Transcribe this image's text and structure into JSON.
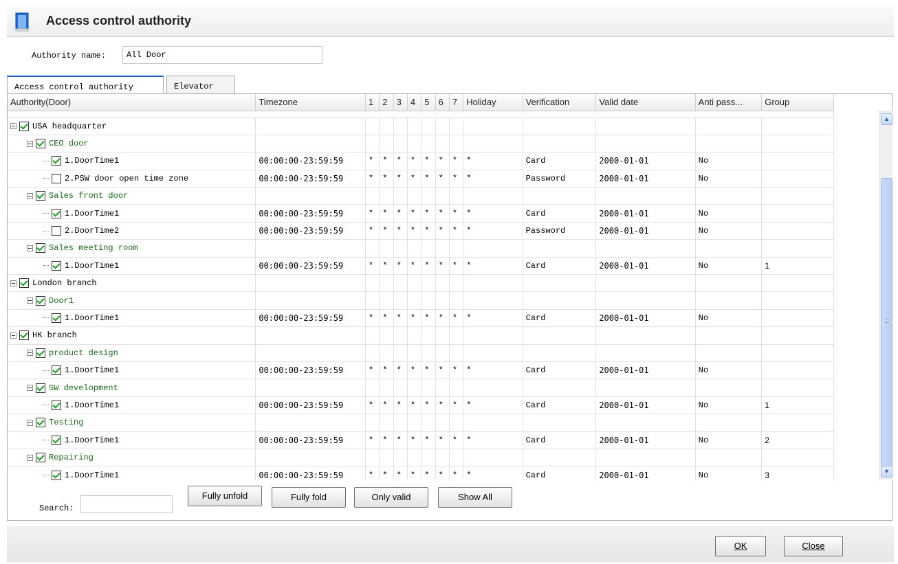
{
  "window": {
    "title": "Access control authority",
    "title_icon": "door-icon"
  },
  "authority": {
    "label": "Authority name:",
    "value": "All Door"
  },
  "tabs": [
    {
      "label": "Access control authority",
      "active": true
    },
    {
      "label": "Elevator",
      "active": false
    }
  ],
  "grid": {
    "columns": [
      "Authority(Door)",
      "Timezone",
      "1",
      "2",
      "3",
      "4",
      "5",
      "6",
      "7",
      "Holiday",
      "Verification",
      "Valid date",
      "Anti pass...",
      "Group"
    ],
    "rows": [
      {
        "level": 0,
        "label": "USA headquarter",
        "color": "#000000"
      },
      {
        "level": 1,
        "label": "CEO door",
        "color": "#1a6b1a"
      },
      {
        "level": 2,
        "label": "1.DoorTime1",
        "checked": true,
        "timezone": "00:00:00-23:59:59",
        "days": [
          "*",
          "*",
          "*",
          "*",
          "*",
          "*",
          "*"
        ],
        "holiday": "*",
        "verification": "Card",
        "valid": "2000-01-01",
        "anti": "No",
        "group": ""
      },
      {
        "level": 2,
        "label": "2.PSW door open time zone",
        "checked": false,
        "timezone": "00:00:00-23:59:59",
        "days": [
          "*",
          "*",
          "*",
          "*",
          "*",
          "*",
          "*"
        ],
        "holiday": "*",
        "verification": "Password",
        "valid": "2000-01-01",
        "anti": "No",
        "group": ""
      },
      {
        "level": 1,
        "label": "Sales front door",
        "color": "#1a6b1a"
      },
      {
        "level": 2,
        "label": "1.DoorTime1",
        "checked": true,
        "timezone": "00:00:00-23:59:59",
        "days": [
          "*",
          "*",
          "*",
          "*",
          "*",
          "*",
          "*"
        ],
        "holiday": "*",
        "verification": "Card",
        "valid": "2000-01-01",
        "anti": "No",
        "group": ""
      },
      {
        "level": 2,
        "label": "2.DoorTime2",
        "checked": false,
        "timezone": "00:00:00-23:59:59",
        "days": [
          "*",
          "*",
          "*",
          "*",
          "*",
          "*",
          "*"
        ],
        "holiday": "*",
        "verification": "Password",
        "valid": "2000-01-01",
        "anti": "No",
        "group": ""
      },
      {
        "level": 1,
        "label": "Sales meeting room",
        "color": "#1a6b1a"
      },
      {
        "level": 2,
        "label": "1.DoorTime1",
        "checked": true,
        "timezone": "00:00:00-23:59:59",
        "days": [
          "*",
          "*",
          "*",
          "*",
          "*",
          "*",
          "*"
        ],
        "holiday": "*",
        "verification": "Card",
        "valid": "2000-01-01",
        "anti": "No",
        "group": "1"
      },
      {
        "level": 0,
        "label": "London branch",
        "color": "#000000"
      },
      {
        "level": 1,
        "label": "Door1",
        "color": "#1a6b1a"
      },
      {
        "level": 2,
        "label": "1.DoorTime1",
        "checked": true,
        "timezone": "00:00:00-23:59:59",
        "days": [
          "*",
          "*",
          "*",
          "*",
          "*",
          "*",
          "*"
        ],
        "holiday": "*",
        "verification": "Card",
        "valid": "2000-01-01",
        "anti": "No",
        "group": ""
      },
      {
        "level": 0,
        "label": "HK branch",
        "color": "#000000"
      },
      {
        "level": 1,
        "label": "product design",
        "color": "#1a6b1a"
      },
      {
        "level": 2,
        "label": "1.DoorTime1",
        "checked": true,
        "timezone": "00:00:00-23:59:59",
        "days": [
          "*",
          "*",
          "*",
          "*",
          "*",
          "*",
          "*"
        ],
        "holiday": "*",
        "verification": "Card",
        "valid": "2000-01-01",
        "anti": "No",
        "group": ""
      },
      {
        "level": 1,
        "label": "SW development",
        "color": "#1a6b1a"
      },
      {
        "level": 2,
        "label": "1.DoorTime1",
        "checked": true,
        "timezone": "00:00:00-23:59:59",
        "days": [
          "*",
          "*",
          "*",
          "*",
          "*",
          "*",
          "*"
        ],
        "holiday": "*",
        "verification": "Card",
        "valid": "2000-01-01",
        "anti": "No",
        "group": "1"
      },
      {
        "level": 1,
        "label": "Testing",
        "color": "#1a6b1a"
      },
      {
        "level": 2,
        "label": "1.DoorTime1",
        "checked": true,
        "timezone": "00:00:00-23:59:59",
        "days": [
          "*",
          "*",
          "*",
          "*",
          "*",
          "*",
          "*"
        ],
        "holiday": "*",
        "verification": "Card",
        "valid": "2000-01-01",
        "anti": "No",
        "group": "2"
      },
      {
        "level": 1,
        "label": "Repairing",
        "color": "#1a6b1a"
      },
      {
        "level": 2,
        "label": "1.DoorTime1",
        "checked": true,
        "timezone": "00:00:00-23:59:59",
        "days": [
          "*",
          "*",
          "*",
          "*",
          "*",
          "*",
          "*"
        ],
        "holiday": "*",
        "verification": "Card",
        "valid": "2000-01-01",
        "anti": "No",
        "group": "3"
      }
    ]
  },
  "search": {
    "label": "Search:",
    "value": ""
  },
  "buttons": {
    "unfold": "Fully unfold",
    "fold": "Fully fold",
    "valid": "Only valid",
    "all": "Show All"
  },
  "footer": {
    "ok": "OK",
    "close": "Close"
  }
}
